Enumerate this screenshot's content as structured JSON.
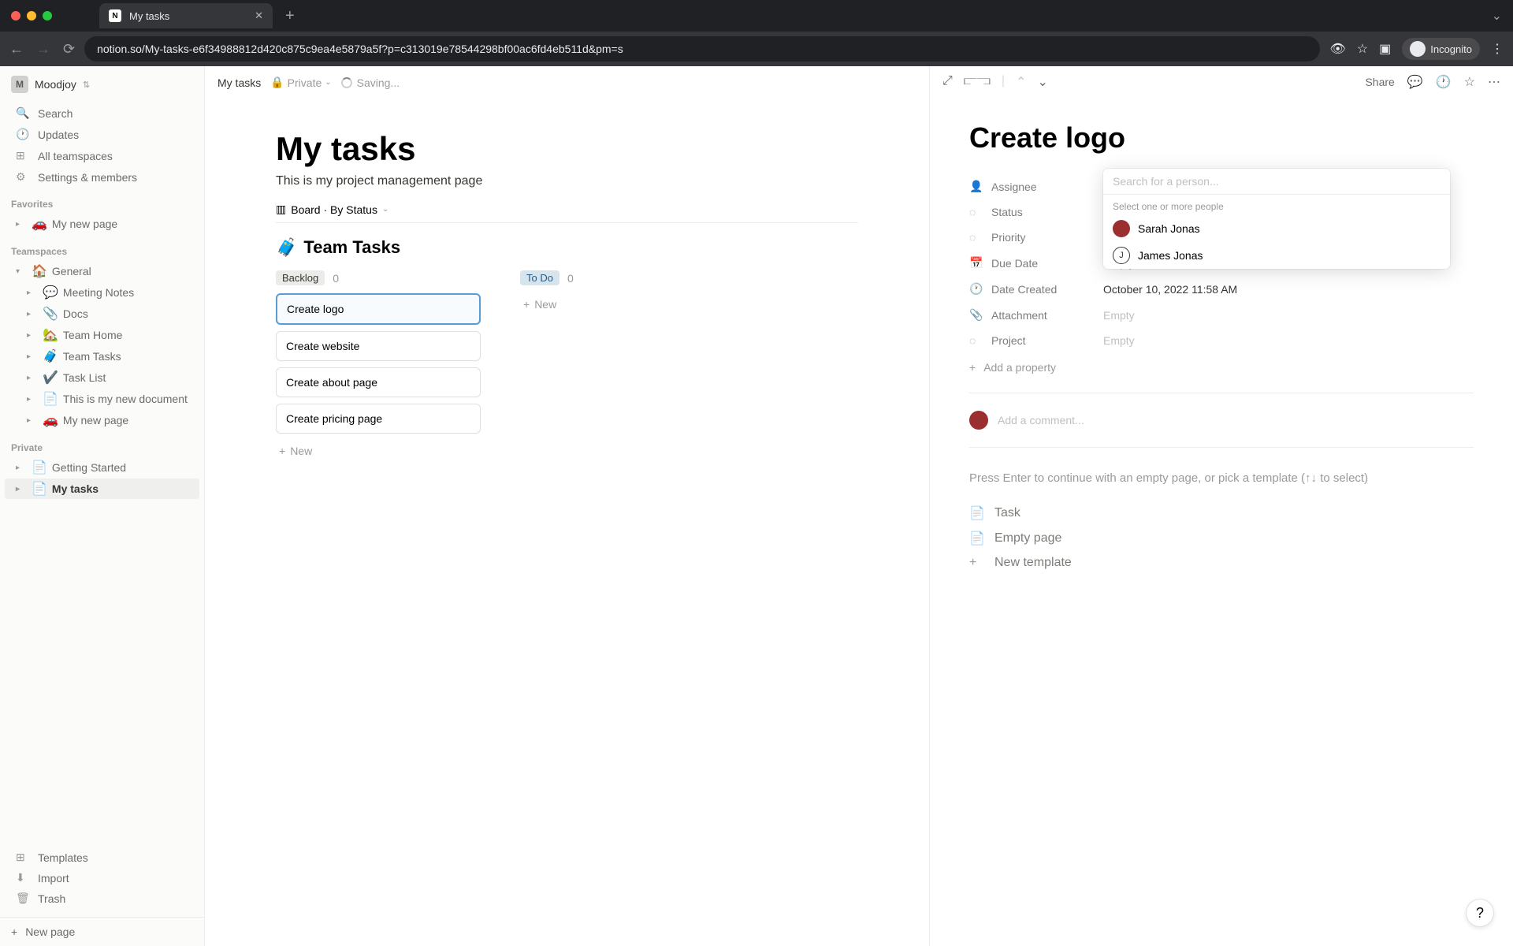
{
  "browser": {
    "tabTitle": "My tasks",
    "url": "notion.so/My-tasks-e6f34988812d420c875c9ea4e5879a5f?p=c313019e78544298bf00ac6fd4eb511d&pm=s",
    "incognitoLabel": "Incognito"
  },
  "workspace": {
    "badge": "M",
    "name": "Moodjoy"
  },
  "sidebarTop": {
    "search": "Search",
    "updates": "Updates",
    "teamspaces": "All teamspaces",
    "settings": "Settings & members"
  },
  "sections": {
    "favorites": "Favorites",
    "teamspaces": "Teamspaces",
    "private": "Private"
  },
  "favorites": [
    {
      "emoji": "🚗",
      "label": "My new page"
    }
  ],
  "teamspaceItems": [
    {
      "emoji": "🏠",
      "label": "General",
      "indent": 0,
      "open": true
    },
    {
      "emoji": "💬",
      "label": "Meeting Notes",
      "indent": 1
    },
    {
      "emoji": "📎",
      "label": "Docs",
      "indent": 1
    },
    {
      "emoji": "🏡",
      "label": "Team Home",
      "indent": 1
    },
    {
      "emoji": "🧳",
      "label": "Team Tasks",
      "indent": 1
    },
    {
      "emoji": "✔️",
      "label": "Task List",
      "indent": 1
    },
    {
      "emoji": "📄",
      "label": "This is my new document",
      "indent": 1
    },
    {
      "emoji": "🚗",
      "label": "My new page",
      "indent": 1
    }
  ],
  "privateItems": [
    {
      "emoji": "📄",
      "label": "Getting Started"
    },
    {
      "emoji": "📄",
      "label": "My tasks",
      "active": true
    }
  ],
  "sidebarBottom": {
    "templates": "Templates",
    "import": "Import",
    "trash": "Trash",
    "newPage": "New page"
  },
  "topbar": {
    "breadcrumb": "My tasks",
    "privateLabel": "Private",
    "savingLabel": "Saving...",
    "share": "Share"
  },
  "page": {
    "title": "My tasks",
    "description": "This is my project management page",
    "viewLabel": "Board · By Status",
    "dbTitle": "Team Tasks",
    "dbEmoji": "🧳"
  },
  "board": {
    "columns": [
      {
        "name": "Backlog",
        "count": 0,
        "pill": "pill-backlog",
        "cards": [
          {
            "title": "Create logo",
            "selected": true
          },
          {
            "title": "Create website"
          },
          {
            "title": "Create about page"
          },
          {
            "title": "Create pricing page"
          }
        ]
      },
      {
        "name": "To Do",
        "count": 0,
        "pill": "pill-todo",
        "cards": []
      }
    ],
    "newLabel": "New"
  },
  "detail": {
    "title": "Create logo",
    "properties": [
      {
        "icon": "person",
        "label": "Assignee",
        "value": "",
        "popup": true
      },
      {
        "icon": "status",
        "label": "Status",
        "value": ""
      },
      {
        "icon": "status",
        "label": "Priority",
        "value": ""
      },
      {
        "icon": "calendar",
        "label": "Due Date",
        "value": "Empty",
        "empty": true
      },
      {
        "icon": "clock",
        "label": "Date Created",
        "value": "October 10, 2022 11:58 AM"
      },
      {
        "icon": "clip",
        "label": "Attachment",
        "value": "Empty",
        "empty": true
      },
      {
        "icon": "status",
        "label": "Project",
        "value": "Empty",
        "empty": true
      }
    ],
    "addProperty": "Add a property",
    "commentPlaceholder": "Add a comment...",
    "templateHint": "Press Enter to continue with an empty page, or pick a template (↑↓ to select)",
    "templates": [
      {
        "icon": "page",
        "label": "Task"
      },
      {
        "icon": "page",
        "label": "Empty page"
      },
      {
        "icon": "plus",
        "label": "New template"
      }
    ]
  },
  "personPicker": {
    "placeholder": "Search for a person...",
    "hint": "Select one or more people",
    "options": [
      {
        "name": "Sarah Jonas",
        "avatarClass": "av-sarah",
        "initial": ""
      },
      {
        "name": "James Jonas",
        "avatarClass": "av-james",
        "initial": "J"
      }
    ]
  }
}
